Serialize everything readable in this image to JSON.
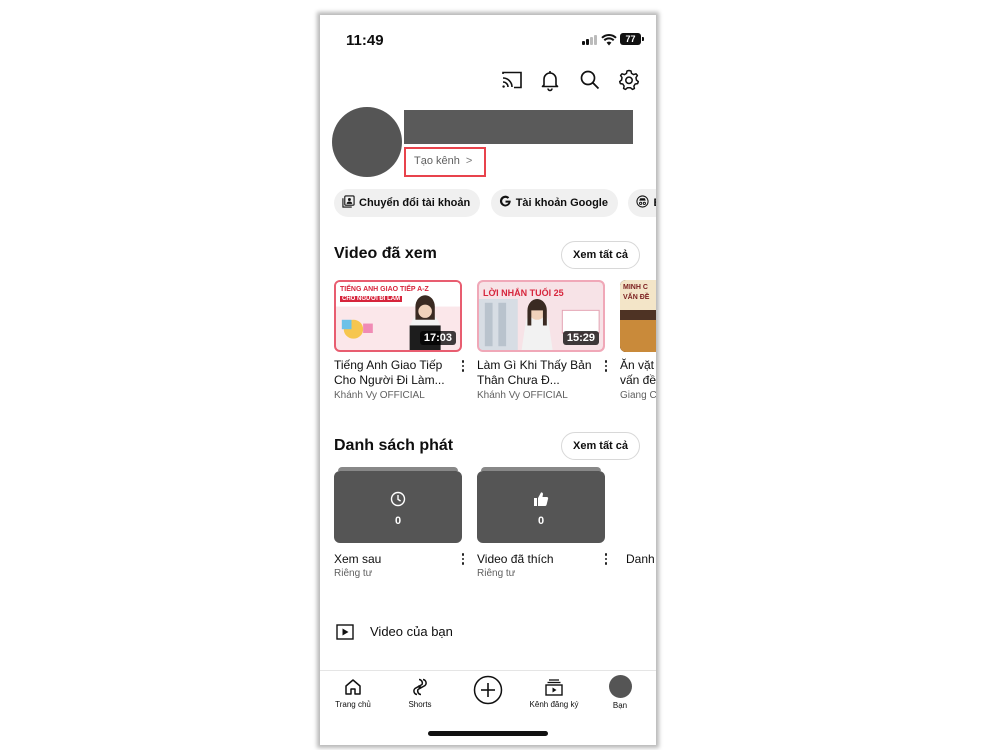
{
  "status": {
    "time": "11:49",
    "battery": "77"
  },
  "top_icons": [
    "cast-icon",
    "bell-icon",
    "search-icon",
    "gear-icon"
  ],
  "profile": {
    "create_channel": "Tạo kênh",
    "chevron": ">"
  },
  "chips": [
    {
      "label": "Chuyển đổi tài khoản",
      "icon": "switch-account-icon"
    },
    {
      "label": "Tài khoản Google",
      "icon": "google-icon"
    },
    {
      "label": "B",
      "icon": "incognito-icon"
    }
  ],
  "history": {
    "title": "Video đã xem",
    "see_all": "Xem tất cả",
    "videos": [
      {
        "title": "Tiếng Anh Giao Tiếp Cho Người Đi Làm...",
        "channel": "Khánh Vy OFFICIAL",
        "duration": "17:03",
        "thumb_text_1": "TIẾNG ANH GIAO TIẾP A-Z",
        "thumb_text_2": "CHO NGƯỜI ĐI LÀM"
      },
      {
        "title": "Làm Gì Khi Thấy Bản Thân Chưa Đ...",
        "channel": "Khánh Vy OFFICIAL",
        "duration": "15:29",
        "thumb_text_1": "LỜI NHẮN TUỔI 25",
        "thumb_text_2": ""
      },
      {
        "title": "Ăn vặt vấn đề",
        "channel": "Giang C",
        "duration": "",
        "thumb_text_1": "MINH C",
        "thumb_text_2": "VẤN ĐỀ"
      }
    ]
  },
  "playlists": {
    "title": "Danh sách phát",
    "see_all": "Xem tất cả",
    "items": [
      {
        "title": "Xem sau",
        "subtitle": "Riêng tư",
        "count": "0",
        "icon": "clock-icon"
      },
      {
        "title": "Video đã thích",
        "subtitle": "Riêng tư",
        "count": "0",
        "icon": "thumbs-up-icon"
      },
      {
        "title": "Danh",
        "subtitle": "",
        "count": "",
        "icon": ""
      }
    ]
  },
  "your_videos": {
    "label": "Video của bạn",
    "icon": "play-icon"
  },
  "bottom_nav": [
    {
      "label": "Trang chủ",
      "icon": "home-icon"
    },
    {
      "label": "Shorts",
      "icon": "shorts-icon"
    },
    {
      "label": "",
      "icon": "create-icon"
    },
    {
      "label": "Kênh đăng ký",
      "icon": "subscriptions-icon"
    },
    {
      "label": "Bạn",
      "icon": "avatar"
    }
  ]
}
